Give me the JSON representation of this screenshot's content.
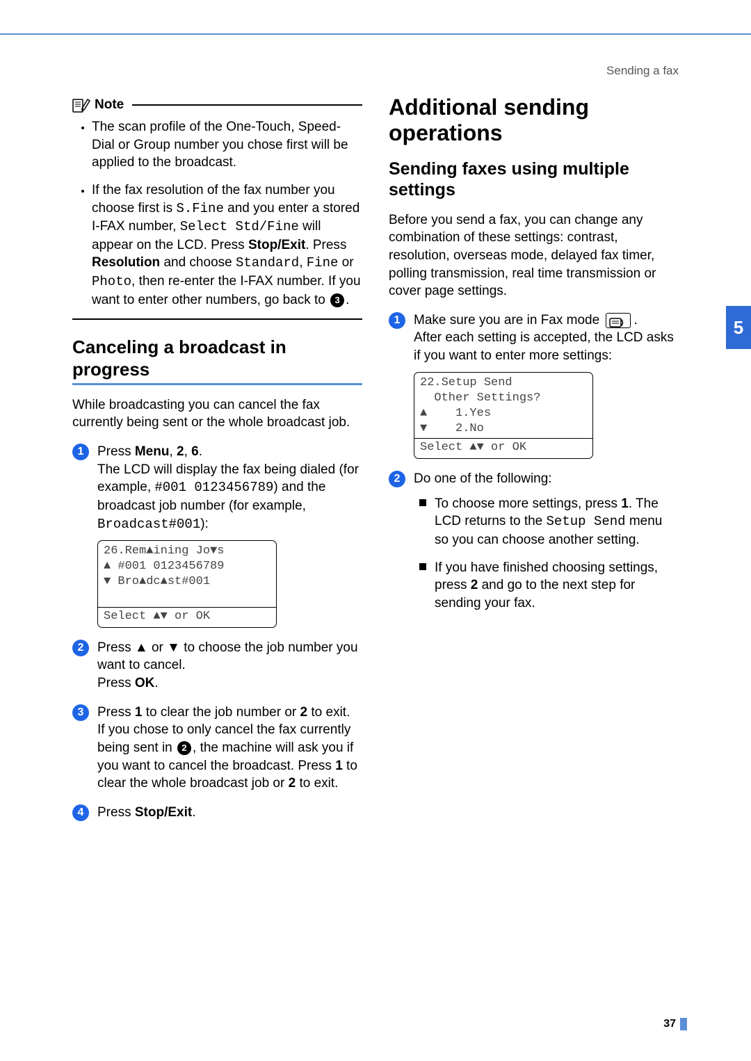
{
  "running_head": "Sending a fax",
  "page_number": "37",
  "side_tab": "5",
  "left": {
    "note": {
      "title": "Note",
      "bullet1": "The scan profile of the One-Touch, Speed-Dial or Group number you chose first will be applied to the broadcast.",
      "bullet2_a": "If the fax resolution of the fax number you choose first is ",
      "bullet2_sfine": "S.Fine",
      "bullet2_b": " and you enter a stored I-FAX number, ",
      "bullet2_select": "Select Std/Fine",
      "bullet2_c": " will appear on the LCD. Press ",
      "bullet2_stopexit": "Stop/Exit",
      "bullet2_d": ". Press ",
      "bullet2_resolution": "Resolution",
      "bullet2_e": " and choose ",
      "bullet2_standard": "Standard",
      "bullet2_comma1": ", ",
      "bullet2_fine": "Fine",
      "bullet2_or": " or ",
      "bullet2_photo": "Photo",
      "bullet2_f": ", then re-enter the I-FAX number. If you want to enter other numbers, go back to ",
      "bullet2_ref": "3",
      "bullet2_g": "."
    },
    "h2": "Canceling a broadcast in progress",
    "intro": "While broadcasting you can cancel the fax currently being sent or the whole broadcast job.",
    "step1_a": "Press ",
    "step1_menu": "Menu",
    "step1_b": ", ",
    "step1_2": "2",
    "step1_c": ", ",
    "step1_6": "6",
    "step1_d": ".",
    "step1_body_a": "The LCD will display the fax being dialed (for example, ",
    "step1_dial": "#001 0123456789",
    "step1_body_b": ") and the broadcast job number (for example, ",
    "step1_bcast": "Broadcast#001",
    "step1_body_c": "):",
    "lcd1": {
      "l1": "26.Remaining Jobs",
      "l2": "a #001 0123456789",
      "l3": "b Broadcast#001",
      "l4": " ",
      "foot": "Select ab or OK"
    },
    "step2_a": "Press ",
    "step2_up": "a",
    "step2_or": " or ",
    "step2_dn": "b",
    "step2_b": " to choose the job number you want to cancel.",
    "step2_c": "Press ",
    "step2_ok": "OK",
    "step2_d": ".",
    "step3_a": "Press ",
    "step3_1": "1",
    "step3_b": " to clear the job number or ",
    "step3_2": "2",
    "step3_c": " to exit.",
    "step3_body_a": "If you chose to only cancel the fax currently being sent in ",
    "step3_ref": "2",
    "step3_body_b": ", the machine will ask you if you want to cancel the broadcast. Press ",
    "step3_1b": "1",
    "step3_body_c": " to clear the whole broadcast job or ",
    "step3_2b": "2",
    "step3_body_d": " to exit.",
    "step4_a": "Press ",
    "step4_stopexit": "Stop/Exit",
    "step4_b": "."
  },
  "right": {
    "h1": "Additional sending operations",
    "h2": "Sending faxes using multiple settings",
    "intro": "Before you send a fax, you can change any combination of these settings: contrast, resolution, overseas mode, delayed fax timer, polling transmission, real time transmission or cover page settings.",
    "step1_a": "Make sure you are in Fax mode ",
    "step1_b": ".",
    "step1_body": "After each setting is accepted, the LCD asks if you want to enter more settings:",
    "lcd1": {
      "l1": "22.Setup Send",
      "l2": "  Other Settings?",
      "l3": "a    1.Yes",
      "l4": "b    2.No",
      "foot": "Select ab or OK"
    },
    "step2_a": "Do one of the following:",
    "sq1_a": "To choose more settings, press ",
    "sq1_1": "1",
    "sq1_b": ". The LCD returns to the ",
    "sq1_setup": "Setup Send",
    "sq1_c": " menu so you can choose another setting.",
    "sq2_a": "If you have finished choosing settings, press ",
    "sq2_2": "2",
    "sq2_b": " and go to the next step for sending your fax."
  }
}
